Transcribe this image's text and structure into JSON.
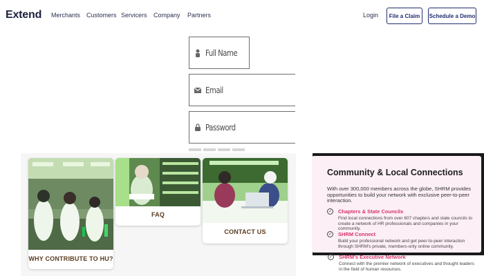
{
  "header": {
    "logo": "Extend",
    "nav": [
      "Merchants",
      "Customers",
      "Servicers",
      "Company",
      "Partners"
    ],
    "login": "Login",
    "file_claim": "File a Claim",
    "schedule_demo": "Schedule a Demo"
  },
  "form": {
    "full_name_placeholder": "Full Name",
    "email_placeholder": "Email",
    "password_placeholder": "Password"
  },
  "cards": [
    {
      "label": "WHY CONTRIBUTE TO HU?"
    },
    {
      "label": "FAQ"
    },
    {
      "label": "CONTACT US"
    }
  ],
  "panel": {
    "title": "Community & Local Connections",
    "intro": "With over 300,000 members across the globe, SHRM provides opportunities to build your network with exclusive peer-to-peer interaction.",
    "features": [
      {
        "title": "Chapters & State Councils",
        "desc": "Find local connections from over 607 chapters and state councils to create a network of HR professionals and companies in your community."
      },
      {
        "title": "SHRM Connect",
        "desc": "Build your professional network and get peer-to-peer interaction through SHRM's private, members-only online community."
      },
      {
        "title": "SHRM's Executive Network",
        "desc": "Connect with the premier network of executives and thought leaders in the field of human resources."
      }
    ]
  },
  "colors": {
    "brand_navy": "#1f2d6e",
    "panel_pink": "#fceff6",
    "feature_pink": "#d6336c",
    "card_caption": "#5a3b1f",
    "photo_green_tint": "#a6e08a"
  }
}
